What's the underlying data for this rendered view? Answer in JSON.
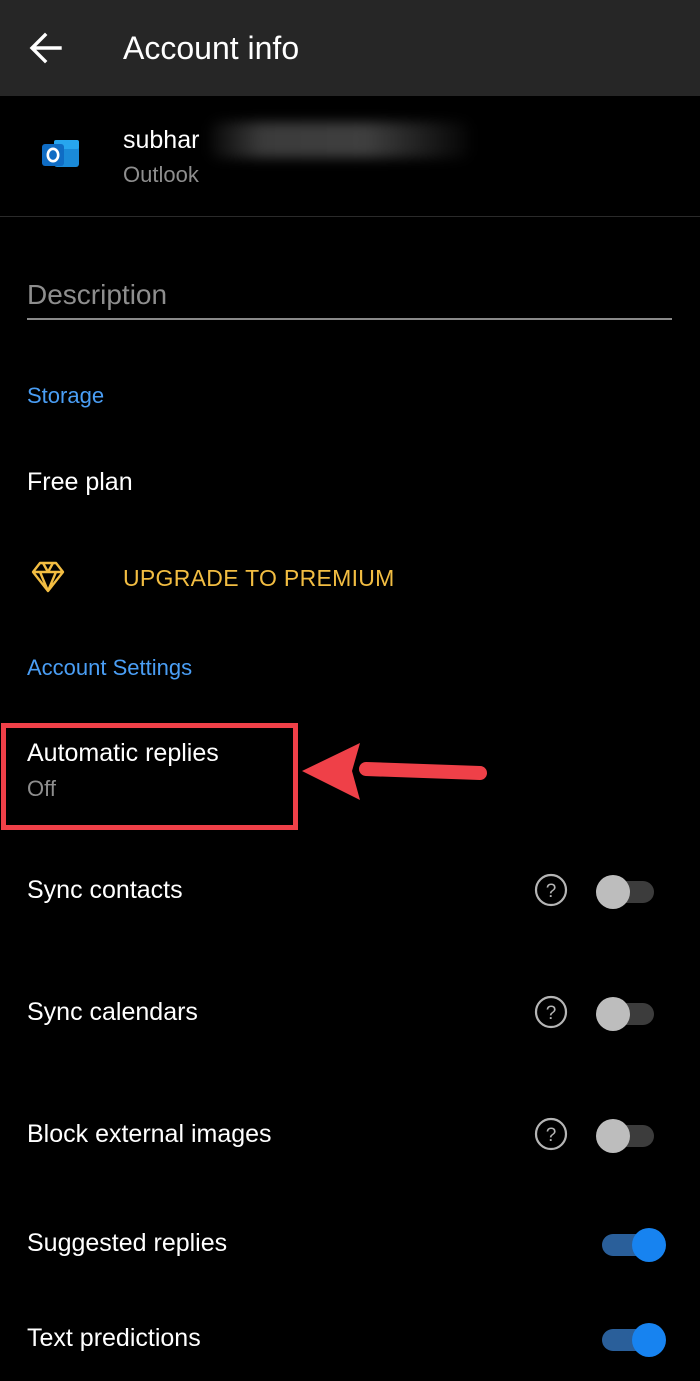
{
  "appbar": {
    "title": "Account info",
    "back_icon": "arrow-left-icon"
  },
  "account": {
    "name": "subhar",
    "type": "Outlook",
    "icon": "outlook-icon"
  },
  "description": {
    "placeholder": "Description",
    "value": ""
  },
  "storage": {
    "header": "Storage",
    "plan": "Free plan",
    "upgrade_label": "UPGRADE TO PREMIUM",
    "upgrade_icon": "diamond-icon"
  },
  "account_settings": {
    "header": "Account Settings",
    "automatic_replies": {
      "label": "Automatic replies",
      "status": "Off"
    },
    "toggles": [
      {
        "label": "Sync contacts",
        "on": false,
        "help": true
      },
      {
        "label": "Sync calendars",
        "on": false,
        "help": true
      },
      {
        "label": "Block external images",
        "on": false,
        "help": true
      },
      {
        "label": "Suggested replies",
        "on": true,
        "help": false
      },
      {
        "label": "Text predictions",
        "on": true,
        "help": false
      }
    ]
  },
  "colors": {
    "accent_blue": "#4a9ef5",
    "premium_gold": "#f2bd42",
    "toggle_on": "#1783f0",
    "annotation_red": "#ef4048"
  }
}
